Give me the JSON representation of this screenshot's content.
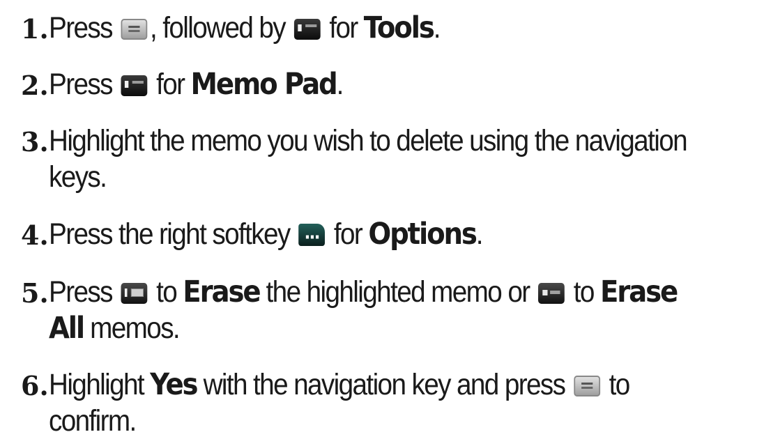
{
  "steps": [
    {
      "number": "1.",
      "line1": {
        "a": "Press",
        "key1_icon": "menu-ok-key-icon",
        "b": ", followed by",
        "key2_icon": "nine-wxyz-key-icon",
        "c": "for",
        "bold": "Tools",
        "d": "."
      }
    },
    {
      "number": "2.",
      "line1": {
        "a": "Press",
        "key1_icon": "six-mno-key-icon",
        "c": "for",
        "bold": "Memo Pad",
        "d": "."
      }
    },
    {
      "number": "3.",
      "line1": "Highlight the memo you wish to delete using the navigation",
      "line2": "keys."
    },
    {
      "number": "4.",
      "line1": {
        "a": "Press the right softkey",
        "key1_icon": "right-softkey-icon",
        "c": "for",
        "bold": "Options",
        "d": "."
      }
    },
    {
      "number": "5.",
      "line1": {
        "a": "Press",
        "key1_icon": "one-key-icon",
        "b": "to",
        "bold1": "Erase",
        "c": "the highlighted memo or",
        "key2_icon": "two-abc-key-icon",
        "d": "to",
        "bold2": "Erase"
      },
      "line2": {
        "bold": "All",
        "a": "memos."
      }
    },
    {
      "number": "6.",
      "line1": {
        "a": "Highlight",
        "bold": "Yes",
        "b": "with the navigation key and press",
        "key1_icon": "menu-ok-key-icon",
        "c": "to"
      },
      "line2": "confirm."
    }
  ]
}
